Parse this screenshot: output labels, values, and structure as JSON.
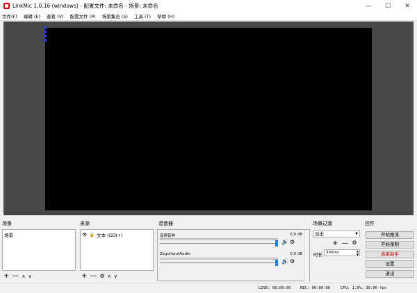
{
  "window": {
    "title": "LinkMic 1.0.16 (windows) - 配置文件: 未命名 - 场景: 未命名",
    "minimize_glyph": "—",
    "maximize_glyph": "☐",
    "close_glyph": "✕"
  },
  "menu": [
    "文件(F)",
    "编辑 (E)",
    "查看 (V)",
    "配置文件 (P)",
    "场景集合 (S)",
    "工具 (T)",
    "帮助 (H)"
  ],
  "docks": {
    "scenes_title": "场景",
    "sources_title": "来源",
    "mixer_title": "混音器",
    "transitions_title": "场景过渡",
    "controls_title": "控件"
  },
  "scenes": {
    "items": [
      "场景"
    ],
    "toolbar": {
      "add": "+",
      "remove": "—",
      "up": "∧",
      "down": "∨"
    }
  },
  "sources": {
    "item_label": "文本 (GDI+)",
    "visible_glyph": "👁",
    "lock_glyph": "🔒",
    "toolbar": {
      "add": "+",
      "remove": "—",
      "settings": "⚙",
      "up": "∧",
      "down": "∨"
    }
  },
  "mixer": {
    "channels": [
      {
        "name": "音频音响",
        "db": "0.0 dB",
        "level": 1.0
      },
      {
        "name": "ZegoInputAudio",
        "db": "0.0 dB",
        "level": 1.0
      }
    ],
    "speaker_glyph": "🔊",
    "gear_glyph": "⚙"
  },
  "transitions": {
    "selected": "淡出",
    "add": "+",
    "remove": "—",
    "settings": "⚙",
    "duration_label": "时长",
    "duration_value": "300ms"
  },
  "controls": {
    "start_stream": "开始推流",
    "start_record": "开始录制",
    "assistant": "连麦助手",
    "settings": "设置",
    "exit": "退出",
    "assistant_color": "#d40000"
  },
  "status": {
    "live": "LIVE: 00:00:00",
    "rec": "REC: 00:00:00",
    "cpu": "CPU: 1.8%, 30.00 fps"
  }
}
